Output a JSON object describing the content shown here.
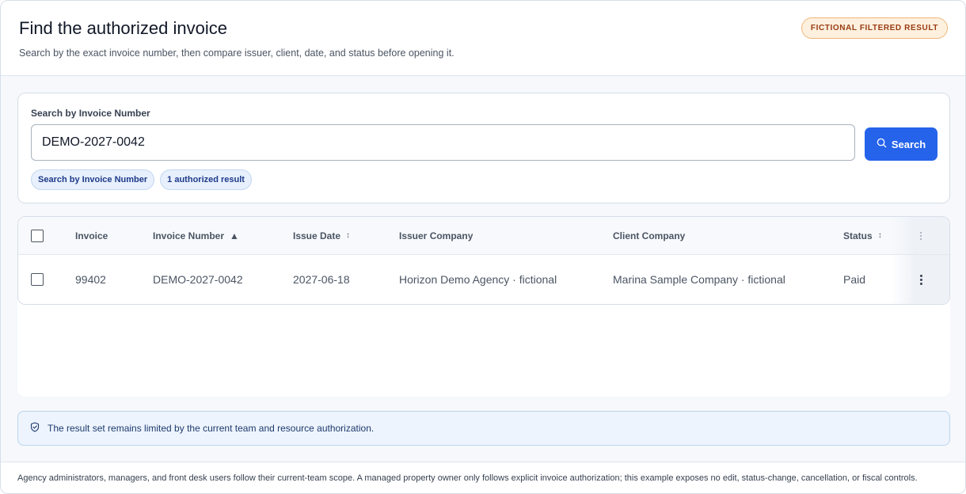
{
  "header": {
    "title": "Find the authorized invoice",
    "subtitle": "Search by the exact invoice number, then compare issuer, client, date, and status before opening it.",
    "badge": "FICTIONAL FILTERED RESULT"
  },
  "search": {
    "label": "Search by Invoice Number",
    "value": "DEMO-2027-0042",
    "button_label": "Search",
    "button_icon": "search-icon",
    "chips": [
      "Search by Invoice Number",
      "1 authorized result"
    ]
  },
  "table": {
    "columns": {
      "invoice": "Invoice",
      "invoice_number": "Invoice Number",
      "issue_date": "Issue Date",
      "issuer_company": "Issuer Company",
      "client_company": "Client Company",
      "status": "Status"
    },
    "sort": {
      "column": "invoice_number",
      "direction": "ascending",
      "sortable": [
        "issue_date",
        "status"
      ]
    },
    "rows": [
      {
        "invoice": "99402",
        "invoice_number": "DEMO-2027-0042",
        "issue_date": "2027-06-18",
        "issuer_company": "Horizon Demo Agency · fictional",
        "client_company": "Marina Sample Company · fictional",
        "status": "Paid"
      }
    ]
  },
  "notice": {
    "icon": "shield-icon",
    "text": "The result set remains limited by the current team and resource authorization."
  },
  "footer": {
    "text": "Agency administrators, managers, and front desk users follow their current-team scope. A managed property owner only follows explicit invoice authorization; this example exposes no edit, status-change, cancellation, or fiscal controls."
  },
  "colors": {
    "accent": "#2563eb",
    "badge_bg": "#fdf0de",
    "badge_text": "#9a3b12",
    "notice_bg": "#edf4fd"
  }
}
